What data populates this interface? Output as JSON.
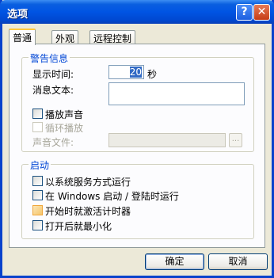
{
  "window": {
    "title": "选项",
    "help_glyph": "?",
    "close_glyph": "✕"
  },
  "tabs": [
    {
      "label": "普通"
    },
    {
      "label": "外观"
    },
    {
      "label": "远程控制"
    }
  ],
  "alert_group": {
    "title": "警告信息",
    "display_time_label": "显示时间:",
    "display_time_value": "20",
    "seconds_unit": "秒",
    "message_label": "消息文本:",
    "message_value": "",
    "play_sound_label": "播放声音",
    "loop_label": "循环播放",
    "sound_file_label": "声音文件:",
    "sound_file_value": "",
    "browse_label": "..."
  },
  "startup_group": {
    "title": "启动",
    "options": [
      {
        "label": "以系统服务方式运行"
      },
      {
        "label": "在 Windows 启动 / 登陆时运行"
      },
      {
        "label": "开始时就激活计时器"
      },
      {
        "label": "打开后就最小化"
      }
    ]
  },
  "buttons": {
    "ok": "确定",
    "cancel": "取消"
  }
}
